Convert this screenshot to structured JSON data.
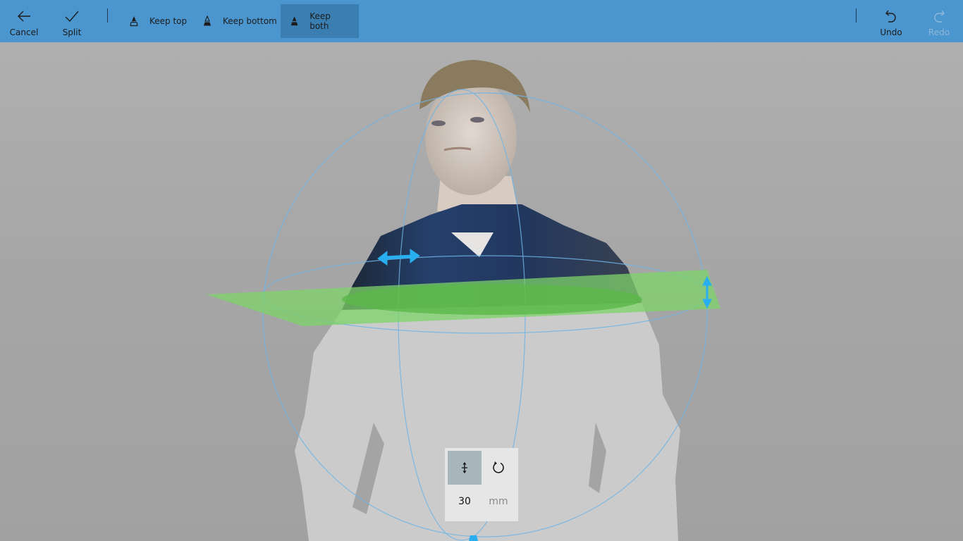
{
  "toolbar": {
    "cancel": {
      "label": "Cancel",
      "icon": "arrow-left-icon"
    },
    "split": {
      "label": "Split",
      "icon": "checkmark-icon"
    },
    "keep_options": [
      {
        "label": "Keep top",
        "icon": "keep-top-icon",
        "active": false
      },
      {
        "label": "Keep bottom",
        "icon": "keep-bottom-icon",
        "active": false
      },
      {
        "label": "Keep both",
        "icon": "keep-both-icon",
        "active": true
      }
    ],
    "undo": {
      "label": "Undo",
      "icon": "undo-icon",
      "enabled": true
    },
    "redo": {
      "label": "Redo",
      "icon": "redo-icon",
      "enabled": false
    }
  },
  "transform_panel": {
    "modes": [
      {
        "name": "move",
        "icon": "move-icon",
        "active": true
      },
      {
        "name": "rotate",
        "icon": "rotate-icon",
        "active": false
      }
    ],
    "value": "30",
    "unit": "mm"
  },
  "colors": {
    "toolbar_bg": "#4b96cf",
    "active_button": "#3a7eb2",
    "gizmo_handle": "#29aef0",
    "cut_plane": "#7ed36a"
  }
}
